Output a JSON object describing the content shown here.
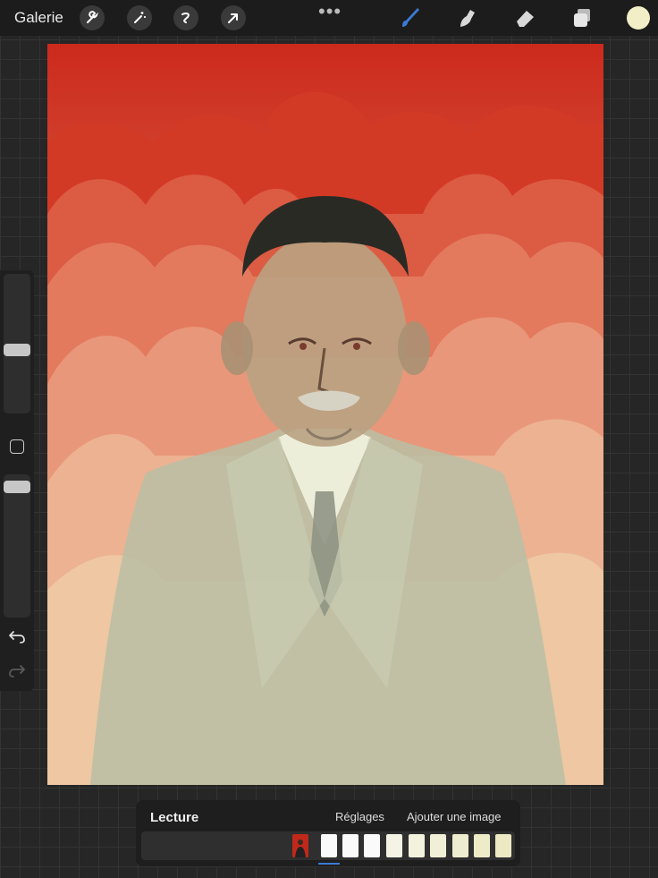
{
  "topbar": {
    "gallery_label": "Galerie",
    "more_label": "•••",
    "tools_left": [
      "wrench-icon",
      "magic-wand-icon",
      "selection-icon",
      "move-arrow-icon"
    ],
    "tools_right": [
      "brush-icon",
      "smudge-icon",
      "eraser-icon",
      "layers-icon"
    ],
    "active_tool": "brush-icon",
    "current_color": "#f2efc8"
  },
  "sidebar": {
    "brush_size_level": 0.45,
    "opacity_level": 0.92
  },
  "animation_panel": {
    "title": "Lecture",
    "settings_label": "Réglages",
    "add_frame_label": "Ajouter une image",
    "frame_count": 10,
    "current_frame": 1
  },
  "colors": {
    "accent": "#3a7bd5",
    "sky_top": "#cc2a1c",
    "sky_bottom": "#efc8a4"
  }
}
